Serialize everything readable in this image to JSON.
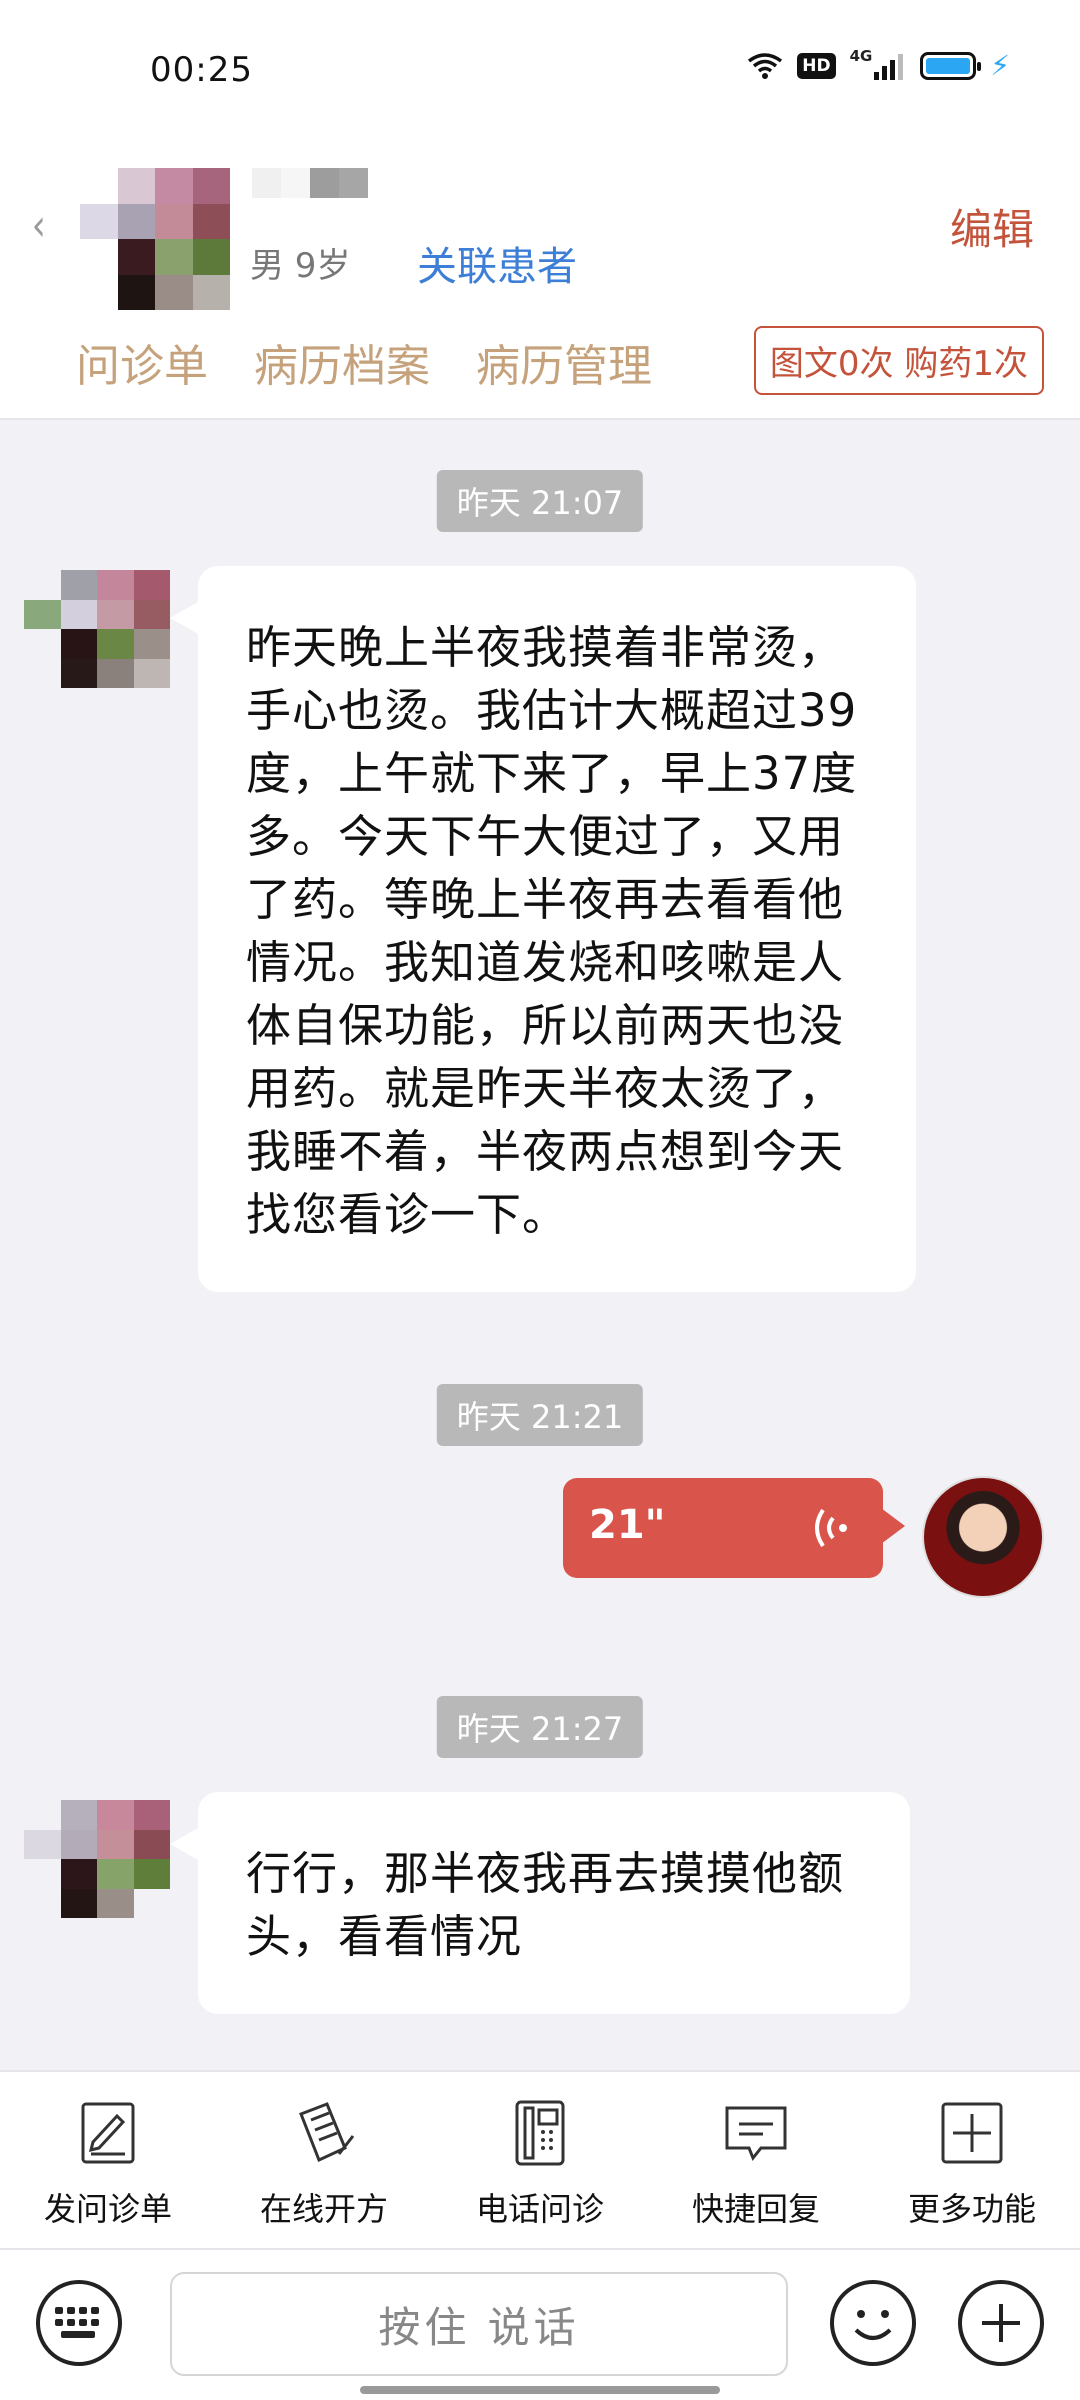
{
  "status_bar": {
    "time": "00:25",
    "hd_label": "HD",
    "network_label": "4G"
  },
  "header": {
    "patient_gender_age": "男 9岁",
    "link_patient_label": "关联患者",
    "edit_label": "编辑",
    "tabs": [
      {
        "label": "问诊单"
      },
      {
        "label": "病历档案"
      },
      {
        "label": "病历管理"
      }
    ],
    "stats_label": "图文0次 购药1次"
  },
  "messages": [
    {
      "time": "昨天 21:07",
      "sender": "patient",
      "type": "text",
      "text": "昨天晚上半夜我摸着非常烫，手心也烫。我估计大概超过39度，上午就下来了，早上37度多。今天下午大便过了，又用了药。等晚上半夜再去看看他情况。我知道发烧和咳嗽是人体自保功能，所以前两天也没用药。就是昨天半夜太烫了，我睡不着，半夜两点想到今天找您看诊一下。"
    },
    {
      "time": "昨天 21:21",
      "sender": "doctor",
      "type": "voice",
      "duration": "21\""
    },
    {
      "time": "昨天 21:27",
      "sender": "patient",
      "type": "text",
      "text": "行行，那半夜我再去摸摸他额头，看看情况"
    }
  ],
  "toolbar": {
    "items": [
      {
        "label": "发问诊单",
        "icon": "form-edit-icon"
      },
      {
        "label": "在线开方",
        "icon": "prescription-icon"
      },
      {
        "label": "电话问诊",
        "icon": "phone-icon"
      },
      {
        "label": "快捷回复",
        "icon": "chat-bubble-icon"
      },
      {
        "label": "更多功能",
        "icon": "plus-square-icon"
      }
    ]
  },
  "input_bar": {
    "hold_to_talk_label": "按住 说话"
  },
  "colors": {
    "accent": "#c4533c",
    "link": "#3d7fd6",
    "voice_bubble": "#d9544a",
    "tab_text": "#c5a27c"
  }
}
